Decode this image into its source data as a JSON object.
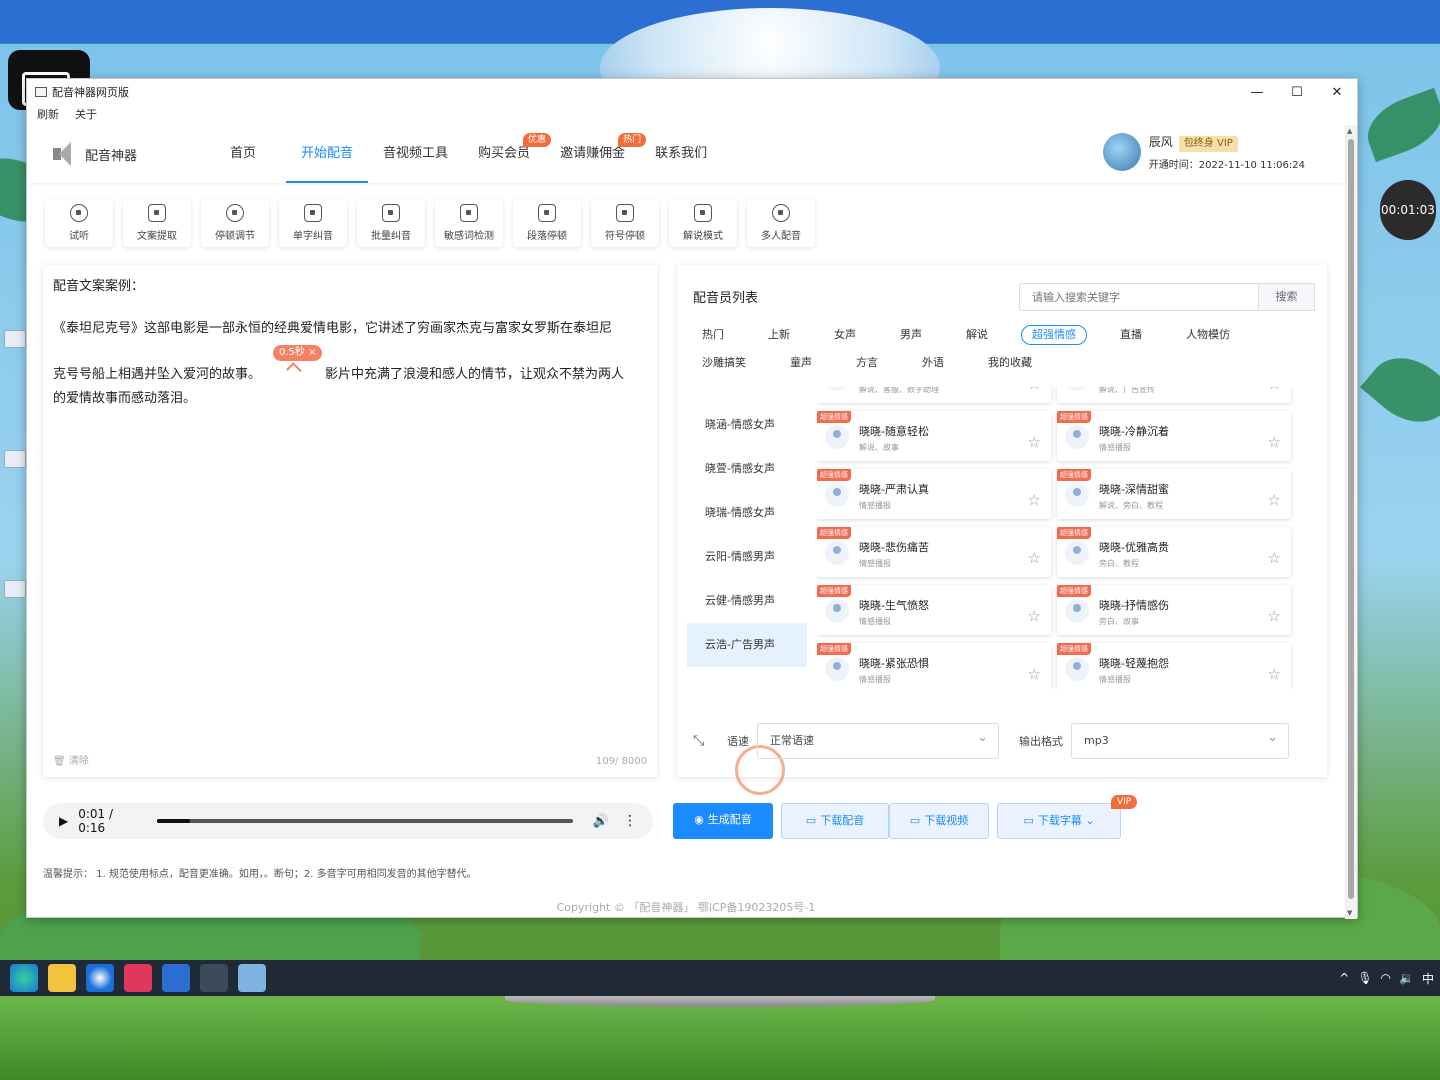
{
  "window": {
    "title": "配音神器网页版",
    "menu": [
      "刷新",
      "关于"
    ],
    "controls": [
      "—",
      "☐",
      "✕"
    ]
  },
  "brand": {
    "name": "配音神器"
  },
  "nav": [
    {
      "label": "首页"
    },
    {
      "label": "开始配音",
      "active": true
    },
    {
      "label": "音视频工具"
    },
    {
      "label": "购买会员",
      "badge": "优惠"
    },
    {
      "label": "邀请赚佣金",
      "badge": "热门"
    },
    {
      "label": "联系我们"
    }
  ],
  "user": {
    "name": "辰风",
    "vip": "包终身 VIP",
    "since": "开通时间：2022-11-10 11:06:24"
  },
  "tools": [
    "试听",
    "文案提取",
    "停顿调节",
    "单字纠音",
    "批量纠音",
    "敏感词检测",
    "段落停顿",
    "符号停顿",
    "解说模式",
    "多人配音"
  ],
  "editor": {
    "heading": "配音文案案例：",
    "line1": "《泰坦尼克号》这部电影是一部永恒的经典爱情电影，它讲述了穷画家杰克与富家女罗斯在泰坦尼",
    "line2a": "克号号船上相遇并坠入爱河的故事。",
    "line2b": "影片中充满了浪漫和感人的情节，让观众不禁为两人",
    "line3": "的爱情故事而感动落泪。",
    "pause_tag": "0.5秒 ×",
    "clear": "清除",
    "count": "109/ 8000"
  },
  "voices": {
    "heading": "配音员列表",
    "search_placeholder": "请输入搜索关键字",
    "search_button": "搜索",
    "categories": [
      "热门",
      "上新",
      "女声",
      "男声",
      "解说",
      "超强情感",
      "直播",
      "人物模仿",
      "沙雕搞笑",
      "童声",
      "方言",
      "外语",
      "我的收藏"
    ],
    "selected_category": "超强情感",
    "list": [
      "晓涵-情感女声",
      "晓萱-情感女声",
      "晓瑞-情感女声",
      "云阳-情感男声",
      "云健-情感男声",
      "云浩-广告男声"
    ],
    "selected_voice": "云浩-广告男声",
    "card_tag": "超强情感",
    "cards": [
      {
        "name": "",
        "desc": "解说、客服、数字助理"
      },
      {
        "name": "",
        "desc": "解说、广告宣传"
      },
      {
        "name": "晓晓-随意轻松",
        "desc": "解说、故事"
      },
      {
        "name": "晓晓-冷静沉着",
        "desc": "情感播报"
      },
      {
        "name": "晓晓-严肃认真",
        "desc": "情感播报"
      },
      {
        "name": "晓晓-深情甜蜜",
        "desc": "解说、旁白、教程"
      },
      {
        "name": "晓晓-悲伤痛苦",
        "desc": "情感播报"
      },
      {
        "name": "晓晓-优雅高贵",
        "desc": "旁白、教程"
      },
      {
        "name": "晓晓-生气愤怒",
        "desc": "情感播报"
      },
      {
        "name": "晓晓-抒情感伤",
        "desc": "旁白、故事"
      },
      {
        "name": "晓晓-紧张恐惧",
        "desc": "情感播报"
      },
      {
        "name": "晓晓-轻蔑抱怨",
        "desc": "情感播报"
      }
    ],
    "speed_label": "语速",
    "speed_value": "正常语速",
    "format_label": "输出格式",
    "format_value": "mp3"
  },
  "player": {
    "time": "0:01 / 0:16",
    "progress": 0.08
  },
  "actions": {
    "generate": "生成配音",
    "download_audio": "下载配音",
    "download_video": "下载视频",
    "download_sub": "下载字幕",
    "vip": "VIP"
  },
  "tips": "温馨提示： 1. 规范使用标点，配音更准确。如用，。断句；2. 多音字可用相同发音的其他字替代。",
  "copyright": "Copyright © 「配音神器」 鄂ICP备19023205号-1",
  "recording_timer": "00:01:03",
  "taskbar": {
    "ime": "中"
  }
}
